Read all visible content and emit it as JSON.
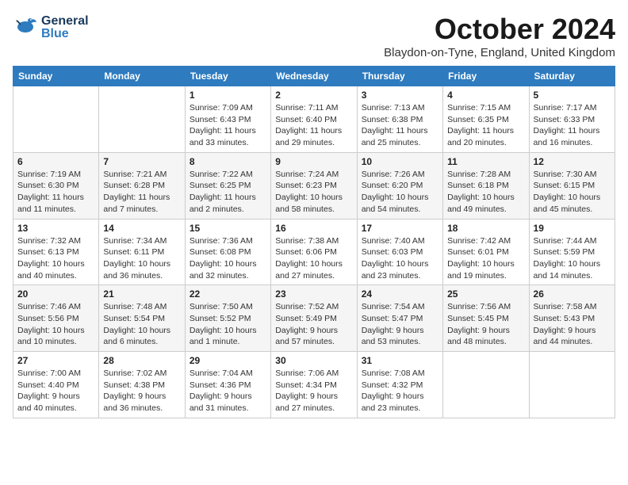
{
  "header": {
    "logo_general": "General",
    "logo_blue": "Blue",
    "month": "October 2024",
    "location": "Blaydon-on-Tyne, England, United Kingdom"
  },
  "days_of_week": [
    "Sunday",
    "Monday",
    "Tuesday",
    "Wednesday",
    "Thursday",
    "Friday",
    "Saturday"
  ],
  "weeks": [
    [
      {
        "day": "",
        "sunrise": "",
        "sunset": "",
        "daylight": ""
      },
      {
        "day": "",
        "sunrise": "",
        "sunset": "",
        "daylight": ""
      },
      {
        "day": "1",
        "sunrise": "Sunrise: 7:09 AM",
        "sunset": "Sunset: 6:43 PM",
        "daylight": "Daylight: 11 hours and 33 minutes."
      },
      {
        "day": "2",
        "sunrise": "Sunrise: 7:11 AM",
        "sunset": "Sunset: 6:40 PM",
        "daylight": "Daylight: 11 hours and 29 minutes."
      },
      {
        "day": "3",
        "sunrise": "Sunrise: 7:13 AM",
        "sunset": "Sunset: 6:38 PM",
        "daylight": "Daylight: 11 hours and 25 minutes."
      },
      {
        "day": "4",
        "sunrise": "Sunrise: 7:15 AM",
        "sunset": "Sunset: 6:35 PM",
        "daylight": "Daylight: 11 hours and 20 minutes."
      },
      {
        "day": "5",
        "sunrise": "Sunrise: 7:17 AM",
        "sunset": "Sunset: 6:33 PM",
        "daylight": "Daylight: 11 hours and 16 minutes."
      }
    ],
    [
      {
        "day": "6",
        "sunrise": "Sunrise: 7:19 AM",
        "sunset": "Sunset: 6:30 PM",
        "daylight": "Daylight: 11 hours and 11 minutes."
      },
      {
        "day": "7",
        "sunrise": "Sunrise: 7:21 AM",
        "sunset": "Sunset: 6:28 PM",
        "daylight": "Daylight: 11 hours and 7 minutes."
      },
      {
        "day": "8",
        "sunrise": "Sunrise: 7:22 AM",
        "sunset": "Sunset: 6:25 PM",
        "daylight": "Daylight: 11 hours and 2 minutes."
      },
      {
        "day": "9",
        "sunrise": "Sunrise: 7:24 AM",
        "sunset": "Sunset: 6:23 PM",
        "daylight": "Daylight: 10 hours and 58 minutes."
      },
      {
        "day": "10",
        "sunrise": "Sunrise: 7:26 AM",
        "sunset": "Sunset: 6:20 PM",
        "daylight": "Daylight: 10 hours and 54 minutes."
      },
      {
        "day": "11",
        "sunrise": "Sunrise: 7:28 AM",
        "sunset": "Sunset: 6:18 PM",
        "daylight": "Daylight: 10 hours and 49 minutes."
      },
      {
        "day": "12",
        "sunrise": "Sunrise: 7:30 AM",
        "sunset": "Sunset: 6:15 PM",
        "daylight": "Daylight: 10 hours and 45 minutes."
      }
    ],
    [
      {
        "day": "13",
        "sunrise": "Sunrise: 7:32 AM",
        "sunset": "Sunset: 6:13 PM",
        "daylight": "Daylight: 10 hours and 40 minutes."
      },
      {
        "day": "14",
        "sunrise": "Sunrise: 7:34 AM",
        "sunset": "Sunset: 6:11 PM",
        "daylight": "Daylight: 10 hours and 36 minutes."
      },
      {
        "day": "15",
        "sunrise": "Sunrise: 7:36 AM",
        "sunset": "Sunset: 6:08 PM",
        "daylight": "Daylight: 10 hours and 32 minutes."
      },
      {
        "day": "16",
        "sunrise": "Sunrise: 7:38 AM",
        "sunset": "Sunset: 6:06 PM",
        "daylight": "Daylight: 10 hours and 27 minutes."
      },
      {
        "day": "17",
        "sunrise": "Sunrise: 7:40 AM",
        "sunset": "Sunset: 6:03 PM",
        "daylight": "Daylight: 10 hours and 23 minutes."
      },
      {
        "day": "18",
        "sunrise": "Sunrise: 7:42 AM",
        "sunset": "Sunset: 6:01 PM",
        "daylight": "Daylight: 10 hours and 19 minutes."
      },
      {
        "day": "19",
        "sunrise": "Sunrise: 7:44 AM",
        "sunset": "Sunset: 5:59 PM",
        "daylight": "Daylight: 10 hours and 14 minutes."
      }
    ],
    [
      {
        "day": "20",
        "sunrise": "Sunrise: 7:46 AM",
        "sunset": "Sunset: 5:56 PM",
        "daylight": "Daylight: 10 hours and 10 minutes."
      },
      {
        "day": "21",
        "sunrise": "Sunrise: 7:48 AM",
        "sunset": "Sunset: 5:54 PM",
        "daylight": "Daylight: 10 hours and 6 minutes."
      },
      {
        "day": "22",
        "sunrise": "Sunrise: 7:50 AM",
        "sunset": "Sunset: 5:52 PM",
        "daylight": "Daylight: 10 hours and 1 minute."
      },
      {
        "day": "23",
        "sunrise": "Sunrise: 7:52 AM",
        "sunset": "Sunset: 5:49 PM",
        "daylight": "Daylight: 9 hours and 57 minutes."
      },
      {
        "day": "24",
        "sunrise": "Sunrise: 7:54 AM",
        "sunset": "Sunset: 5:47 PM",
        "daylight": "Daylight: 9 hours and 53 minutes."
      },
      {
        "day": "25",
        "sunrise": "Sunrise: 7:56 AM",
        "sunset": "Sunset: 5:45 PM",
        "daylight": "Daylight: 9 hours and 48 minutes."
      },
      {
        "day": "26",
        "sunrise": "Sunrise: 7:58 AM",
        "sunset": "Sunset: 5:43 PM",
        "daylight": "Daylight: 9 hours and 44 minutes."
      }
    ],
    [
      {
        "day": "27",
        "sunrise": "Sunrise: 7:00 AM",
        "sunset": "Sunset: 4:40 PM",
        "daylight": "Daylight: 9 hours and 40 minutes."
      },
      {
        "day": "28",
        "sunrise": "Sunrise: 7:02 AM",
        "sunset": "Sunset: 4:38 PM",
        "daylight": "Daylight: 9 hours and 36 minutes."
      },
      {
        "day": "29",
        "sunrise": "Sunrise: 7:04 AM",
        "sunset": "Sunset: 4:36 PM",
        "daylight": "Daylight: 9 hours and 31 minutes."
      },
      {
        "day": "30",
        "sunrise": "Sunrise: 7:06 AM",
        "sunset": "Sunset: 4:34 PM",
        "daylight": "Daylight: 9 hours and 27 minutes."
      },
      {
        "day": "31",
        "sunrise": "Sunrise: 7:08 AM",
        "sunset": "Sunset: 4:32 PM",
        "daylight": "Daylight: 9 hours and 23 minutes."
      },
      {
        "day": "",
        "sunrise": "",
        "sunset": "",
        "daylight": ""
      },
      {
        "day": "",
        "sunrise": "",
        "sunset": "",
        "daylight": ""
      }
    ]
  ]
}
